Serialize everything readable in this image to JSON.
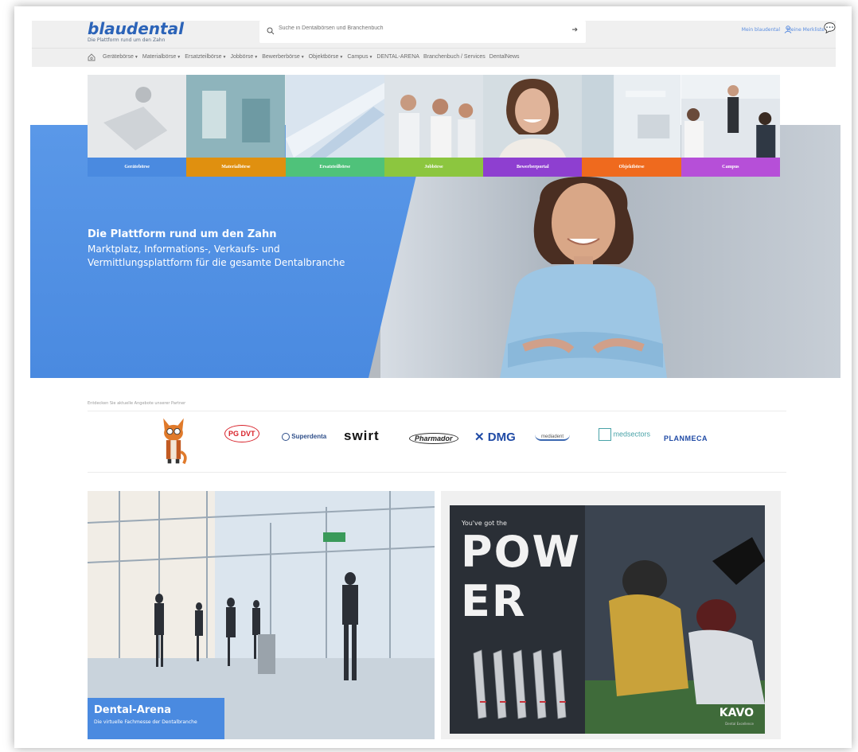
{
  "header": {
    "logo": "blaudental",
    "logo_tagline": "Die Plattform rund um den Zahn",
    "search_placeholder": "Suche in Dentalbörsen und Branchenbuch",
    "account_label": "Mein blaudental",
    "wishlist_label": "Meine Merkliste"
  },
  "nav": {
    "items": [
      {
        "label": "Gerätebörse",
        "dropdown": true
      },
      {
        "label": "Materialbörse",
        "dropdown": true
      },
      {
        "label": "Ersatzteilbörse",
        "dropdown": true
      },
      {
        "label": "Jobbörse",
        "dropdown": true
      },
      {
        "label": "Bewerberbörse",
        "dropdown": true
      },
      {
        "label": "Objektbörse",
        "dropdown": true
      },
      {
        "label": "Campus",
        "dropdown": true
      },
      {
        "label": "DENTAL-ARENA",
        "dropdown": false
      },
      {
        "label": "Branchenbuch / Services",
        "dropdown": false
      },
      {
        "label": "DentalNews",
        "dropdown": false
      }
    ]
  },
  "tiles": [
    {
      "label": "Gerätebörse",
      "color": "#4a8ae0"
    },
    {
      "label": "Materialbörse",
      "color": "#e0900f"
    },
    {
      "label": "Ersatzteilbörse",
      "color": "#4fc27a"
    },
    {
      "label": "Jobbörse",
      "color": "#8cc63f"
    },
    {
      "label": "Bewerberportal",
      "color": "#8e3fd0"
    },
    {
      "label": "Objektbörse",
      "color": "#ef6a1e"
    },
    {
      "label": "Campus",
      "color": "#b64fd8"
    }
  ],
  "hero": {
    "title": "Die Plattform rund um den Zahn",
    "subtitle": "Marktplatz, Informations-, Verkaufs- und Vermittlungsplattform für die gesamte Dentalbranche"
  },
  "partners": {
    "label": "Entdecken Sie aktuelle Angebote unserer Partner",
    "logos": [
      "PG DVT",
      "Superdenta",
      "swirt",
      "Pharmador",
      "DMG",
      "mediadent",
      "medsectors",
      "PLANMECA"
    ]
  },
  "arena": {
    "title": "Dental-Arena",
    "subtitle": "Die virtuelle Fachmesse der Dentalbranche"
  },
  "ad": {
    "tagline": "You've got the",
    "headline_1": "POW",
    "headline_2": "ER",
    "brand": "KAVO",
    "brand_sub": "Dental Excellence"
  },
  "colors": {
    "brand": "#2b63b8",
    "hero_blue": "#4a8ae0"
  }
}
